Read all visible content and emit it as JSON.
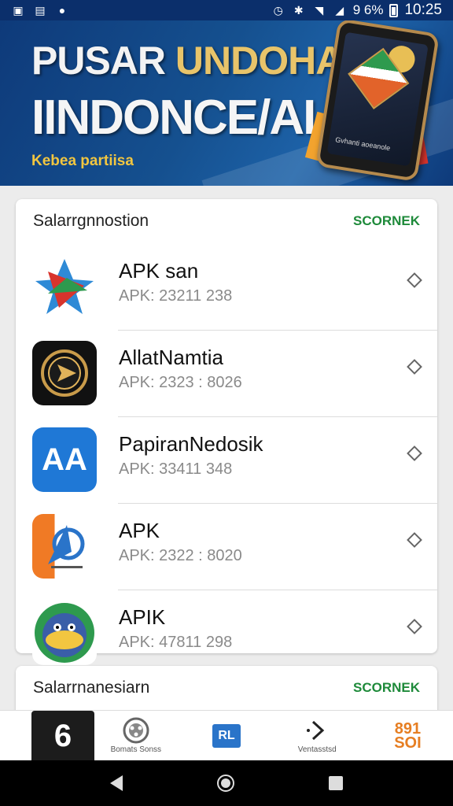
{
  "status_bar": {
    "battery": "9 6%",
    "time": "10:25",
    "icons": [
      "photo-icon",
      "image-icon",
      "shazam-icon",
      "alarm-icon",
      "bluetooth-icon",
      "wifi-icon",
      "signal-icon",
      "battery-icon"
    ]
  },
  "banner": {
    "title_line1_a": "PUSAR ",
    "title_line1_b": "UNDOHAN",
    "title_line2": "IINDONCE/AI",
    "tagline": "Kebea partiisa",
    "phone_label": "Gvhanti aoeanole"
  },
  "section1": {
    "title": "Salarrgnnostion",
    "link": "SCORNEK",
    "apps": [
      {
        "name": "APK  san",
        "version": "APK: 23211 238",
        "icon": "star-arrow-app-icon"
      },
      {
        "name": "AllatNamtia",
        "version": "APK: 2323 : 8026",
        "icon": "gold-emblem-app-icon"
      },
      {
        "name": "PapiranNedosik",
        "version": "APK: 33411 348",
        "icon": "aa-app-icon",
        "icon_text": "AA"
      },
      {
        "name": "APK",
        "version": "APK: 2322 : 8020",
        "icon": "navigator-app-icon"
      },
      {
        "name": "APIK",
        "version": "APK: 47811 298",
        "icon": "cartoon-bird-app-icon"
      }
    ]
  },
  "section2": {
    "title": "Salarrnanesiarn",
    "link": "SCORNEK"
  },
  "bottom_nav": [
    {
      "name": "nav-calculator",
      "label": "",
      "icon_text": "6"
    },
    {
      "name": "nav-bomb",
      "label": "Bomats Sonss"
    },
    {
      "name": "nav-facebook",
      "label": "",
      "icon_text": "RL"
    },
    {
      "name": "nav-share",
      "label": "Ventasstsd"
    },
    {
      "name": "nav-numbers",
      "label": "",
      "icon_text_1": "891",
      "icon_text_2": "SOI"
    }
  ]
}
